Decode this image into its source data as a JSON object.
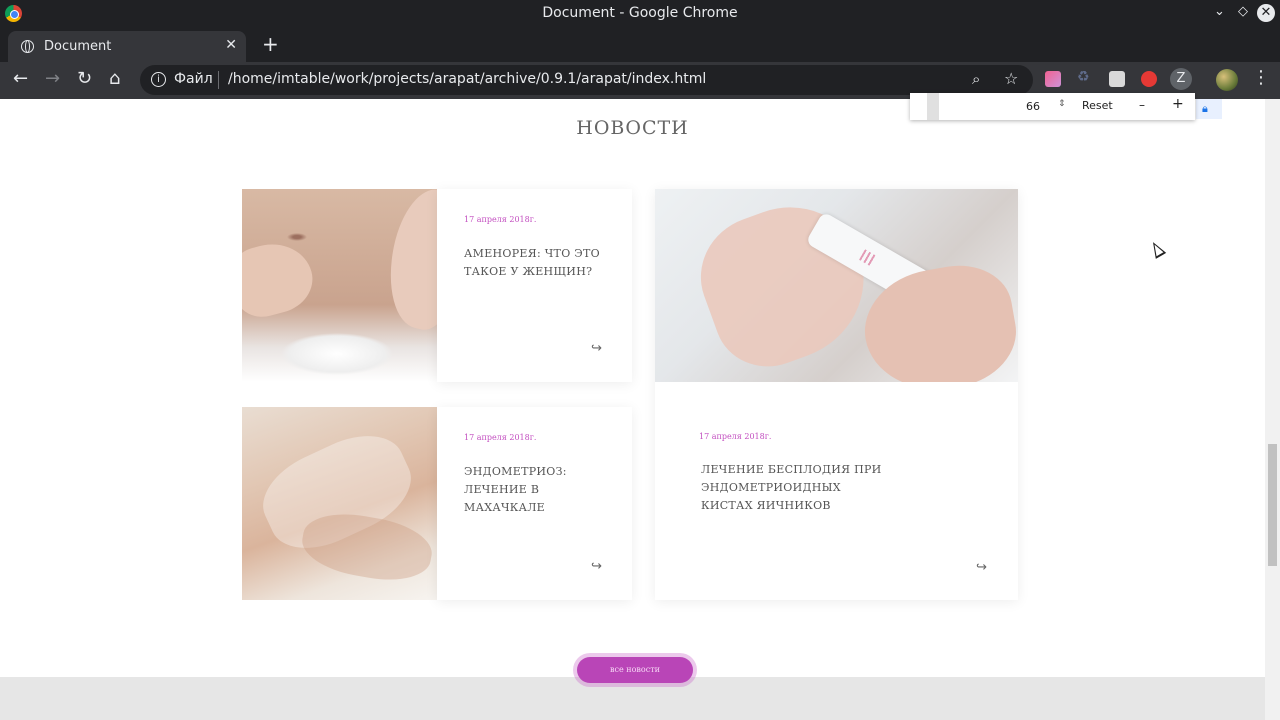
{
  "window": {
    "title": "Document - Google Chrome"
  },
  "tab": {
    "label": "Document"
  },
  "omnibox": {
    "scheme_label": "Файл",
    "url": "/home/imtable/work/projects/arapat/archive/0.9.1/arapat/index.html"
  },
  "zoom_popup": {
    "value": "66",
    "reset_label": "Reset",
    "minus": "–",
    "plus": "+"
  },
  "page": {
    "section_title": "НОВОСТИ",
    "cards": [
      {
        "date": "17 апреля 2018г.",
        "title": "АМЕНОРЕЯ: ЧТО ЭТО ТАКОЕ У ЖЕНЩИН?"
      },
      {
        "date": "17 апреля 2018г.",
        "title": "ЭНДОМЕТРИОЗ: ЛЕЧЕНИЕ В МАХАЧКАЛЕ"
      },
      {
        "date": "17 апреля 2018г.",
        "title": "ЛЕЧЕНИЕ БЕСПЛОДИЯ ПРИ ЭНДОМЕТРИОИДНЫХ КИСТАХ ЯИЧНИКОВ"
      }
    ],
    "all_news_label": "все новости"
  },
  "colors": {
    "accent": "#b945b7",
    "date": "#c34fc0",
    "chrome_dark": "#202124",
    "chrome_toolbar": "#35363a"
  }
}
